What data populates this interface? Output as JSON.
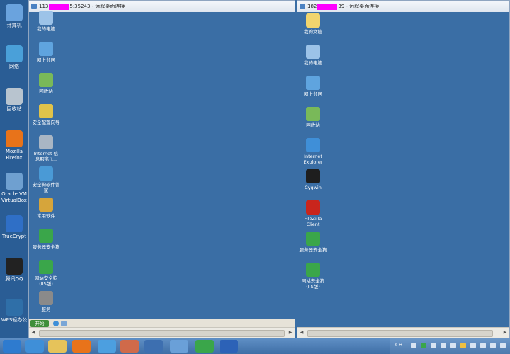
{
  "host_desktop": {
    "icons": [
      {
        "label": "计算机",
        "name": "computer-icon",
        "color": "#6aa3de"
      },
      {
        "label": "网络",
        "name": "network-icon",
        "color": "#4aa0d9"
      },
      {
        "label": "回收站",
        "name": "recycle-bin-icon",
        "color": "#b8c4cf"
      },
      {
        "label": "Mozilla Firefox",
        "name": "firefox-icon",
        "color": "#e8731a"
      },
      {
        "label": "Oracle VM VirtualBox",
        "name": "virtualbox-icon",
        "color": "#6fa0d0"
      },
      {
        "label": "TrueCrypt",
        "name": "truecrypt-icon",
        "color": "#2f6fc6"
      },
      {
        "label": "腾讯QQ",
        "name": "qq-icon",
        "color": "#222222"
      },
      {
        "label": "WPS轻办公",
        "name": "wps-icon",
        "color": "#2f6fa8"
      }
    ]
  },
  "left_window": {
    "title_prefix": "113",
    "title_suffix": "5:35243 - 远程桌面连接",
    "icons": [
      {
        "label": "我的电脑",
        "name": "my-computer-icon",
        "color": "#9cc3e8"
      },
      {
        "label": "网上邻居",
        "name": "network-places-icon",
        "color": "#5fa4df"
      },
      {
        "label": "回收站",
        "name": "recycle-bin-icon",
        "color": "#79b959"
      },
      {
        "label": "安全配置向导",
        "name": "security-wizard-icon",
        "color": "#e0c34a"
      },
      {
        "label": "Internet 信息服务(I...",
        "name": "iis-manager-icon",
        "color": "#a9b6c4"
      },
      {
        "label": "安全狗软件管家",
        "name": "safedog-manager-icon",
        "color": "#4a9ad6"
      },
      {
        "label": "常用软件",
        "name": "common-software-icon",
        "color": "#d6a53b"
      },
      {
        "label": "服务器安全狗",
        "name": "server-safedog-icon",
        "color": "#3aa64a"
      },
      {
        "label": "网站安全狗(IIS版)",
        "name": "website-safedog-icon",
        "color": "#3aa64a"
      },
      {
        "label": "服务",
        "name": "services-icon",
        "color": "#8a8a8a"
      }
    ],
    "start_label": "开始"
  },
  "right_window": {
    "title_prefix": "182",
    "title_suffix": "39 - 远程桌面连接",
    "icons": [
      {
        "label": "我的文档",
        "name": "my-documents-icon",
        "color": "#f1d56e"
      },
      {
        "label": "我的电脑",
        "name": "my-computer-icon",
        "color": "#9cc3e8"
      },
      {
        "label": "网上邻居",
        "name": "network-places-icon",
        "color": "#5fa4df"
      },
      {
        "label": "回收站",
        "name": "recycle-bin-icon",
        "color": "#79b959"
      },
      {
        "label": "Internet Explorer",
        "name": "ie-icon",
        "color": "#3f8fd8"
      },
      {
        "label": "Cygwin",
        "name": "cygwin-icon",
        "color": "#1e1e1e"
      },
      {
        "label": "FileZilla Client",
        "name": "filezilla-icon",
        "color": "#c9251c"
      },
      {
        "label": "服务器安全狗",
        "name": "server-safedog-icon",
        "color": "#3aa64a"
      },
      {
        "label": "网站安全狗(IIS版)",
        "name": "website-safedog-icon",
        "color": "#3aa64a"
      }
    ]
  },
  "taskbar": {
    "items": [
      {
        "name": "start-orb-icon",
        "color": "#2e7bcf"
      },
      {
        "name": "ie-icon",
        "color": "#3f8fd8"
      },
      {
        "name": "explorer-icon",
        "color": "#e6c35a"
      },
      {
        "name": "firefox-icon",
        "color": "#e8731a"
      },
      {
        "name": "cloud-drive-icon",
        "color": "#4c9fe0"
      },
      {
        "name": "contacts-icon",
        "color": "#d06a4a"
      },
      {
        "name": "remote-desktop-icon",
        "color": "#3d6fb0"
      },
      {
        "name": "tool-icon",
        "color": "#6aa0d8"
      },
      {
        "name": "safedog-icon",
        "color": "#3aa64a"
      },
      {
        "name": "wps-writer-icon",
        "color": "#2c62b7"
      }
    ],
    "tray_label": "CH"
  }
}
